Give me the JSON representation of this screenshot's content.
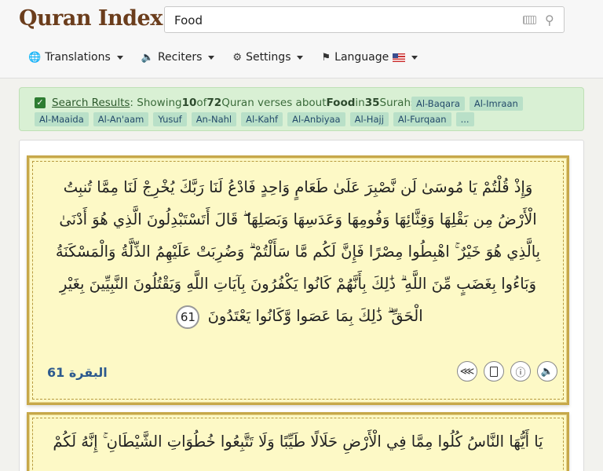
{
  "header": {
    "logo": "Quran Index",
    "search_value": "Food",
    "search_placeholder": ""
  },
  "menu": {
    "translations": "Translations",
    "reciters": "Reciters",
    "settings": "Settings",
    "language": "Language"
  },
  "results": {
    "link_label": "Search Results",
    "showing": ": Showing ",
    "shown_count": "10",
    "of": " of ",
    "total": "72",
    "verses_about": " Quran verses about ",
    "topic": "Food",
    "in": " in ",
    "surah_count": "35",
    "surahs": " Surahs",
    "tags_row1": [
      "Al-Baqara",
      "Al-Imraan"
    ],
    "tags_row2": [
      "Al-Maaida",
      "Al-An'aam",
      "Yusuf",
      "An-Nahl",
      "Al-Kahf",
      "Al-Anbiyaa",
      "Al-Hajj",
      "Al-Furqaan",
      "..."
    ]
  },
  "verses": [
    {
      "text": "وَإِذْ قُلْتُمْ يَا مُوسَىٰ لَن نَّصْبِرَ عَلَىٰ طَعَامٍ وَاحِدٍ فَادْعُ لَنَا رَبَّكَ يُخْرِجْ لَنَا مِمَّا تُنبِتُ الْأَرْضُ مِن بَقْلِهَا وَقِثَّائِهَا وَفُومِهَا وَعَدَسِهَا وَبَصَلِهَا ۖ قَالَ أَتَسْتَبْدِلُونَ الَّذِي هُوَ أَدْنَىٰ بِالَّذِي هُوَ خَيْرٌ ۚ اهْبِطُوا مِصْرًا فَإِنَّ لَكُم مَّا سَأَلْتُمْ ۗ وَضُرِبَتْ عَلَيْهِمُ الذِّلَّةُ وَالْمَسْكَنَةُ وَبَاءُوا بِغَضَبٍ مِّنَ اللَّهِ ۗ ذَٰلِكَ بِأَنَّهُمْ كَانُوا يَكْفُرُونَ بِآيَاتِ اللَّهِ وَيَقْتُلُونَ النَّبِيِّينَ بِغَيْرِ الْحَقِّ ۗ ذَٰلِكَ بِمَا عَصَوا وَّكَانُوا يَعْتَدُونَ",
      "number": "61",
      "reference": "البقرة 61"
    },
    {
      "text": "يَا أَيُّهَا النَّاسُ كُلُوا مِمَّا فِي الْأَرْضِ حَلَالًا طَيِّبًا وَلَا تَتَّبِعُوا خُطُوَاتِ الشَّيْطَانِ ۚ إِنَّهُ لَكُمْ",
      "number": "",
      "reference": ""
    }
  ]
}
